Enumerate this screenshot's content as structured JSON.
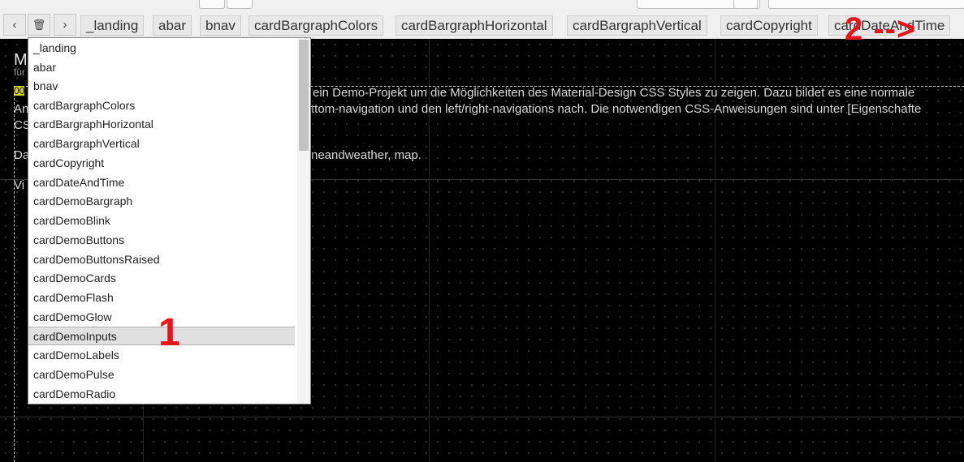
{
  "tabbar": {
    "nav": {
      "prev": "‹",
      "trash": "🗑",
      "next": "›"
    },
    "tabs": [
      "_landing",
      "abar",
      "bnav",
      "cardBargraphColors",
      "cardBargraphHorizontal",
      "cardBargraphVertical",
      "cardCopyright",
      "cardDateAndTime"
    ]
  },
  "canvas": {
    "heading": "M",
    "subheading": "für",
    "highlight": "00",
    "line1": "ein Demo-Projekt um die Möglichkeiten des Material-Design CSS Styles zu zeigen. Dazu bildet es eine normale",
    "line2_prefix": "An",
    "line2": "ttom-navigation und den left/right-navigations nach. Die notwendigen CSS-Anweisungen sind unter [Eigenschafte",
    "line3_prefix": "CS",
    "line4_prefix": "Da",
    "line4": "neandweather, map.",
    "line5_prefix": "Vi"
  },
  "dropdown": {
    "items": [
      "_landing",
      "abar",
      "bnav",
      "cardBargraphColors",
      "cardBargraphHorizontal",
      "cardBargraphVertical",
      "cardCopyright",
      "cardDateAndTime",
      "cardDemoBargraph",
      "cardDemoBlink",
      "cardDemoButtons",
      "cardDemoButtonsRaised",
      "cardDemoCards",
      "cardDemoFlash",
      "cardDemoGlow",
      "cardDemoInputs",
      "cardDemoLabels",
      "cardDemoPulse",
      "cardDemoRadio"
    ],
    "highlighted": "cardDemoInputs"
  },
  "annotations": {
    "one": "1",
    "two": "2 -->"
  },
  "colors": {
    "annotation": "#e8141a",
    "canvas": "#000000",
    "highlight_yellow": "#d4d40a"
  }
}
